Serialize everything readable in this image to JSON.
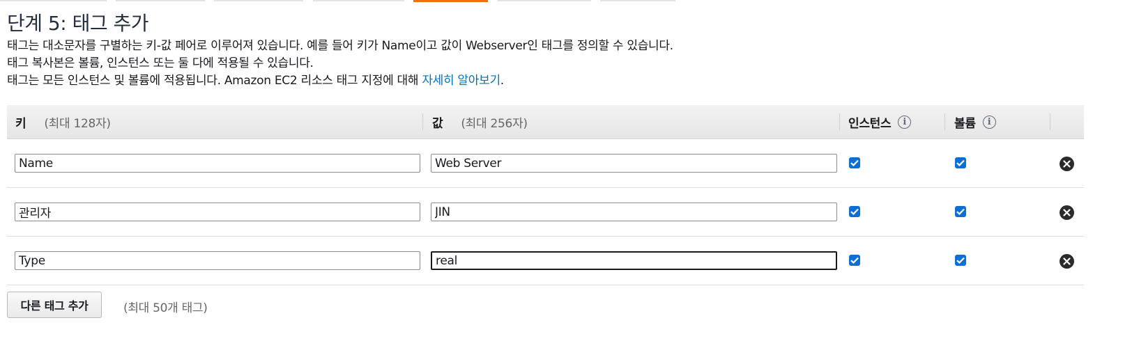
{
  "colors": {
    "accent": "#ec7211",
    "link": "#0073bb",
    "checkbox": "#0b6fd6",
    "header_bg": "#e9e9e9"
  },
  "page": {
    "title": "단계 5: 태그 추가",
    "description": [
      "태그는 대소문자를 구별하는 키-값 페어로 이루어져 있습니다. 예를 들어 키가 Name이고 값이 Webserver인 태그를 정의할 수 있습니다.",
      "태그 복사본은 볼륨, 인스턴스 또는 둘 다에 적용될 수 있습니다.",
      "태그는 모든 인스턴스 및 볼륨에 적용됩니다. Amazon EC2 리소스 태그 지정에 대해 "
    ],
    "learn_more_link": "자세히 알아보기",
    "period": "."
  },
  "table": {
    "headers": {
      "key": "키",
      "key_hint": "(최대 128자)",
      "value": "값",
      "value_hint": "(최대 256자)",
      "instances": "인스턴스",
      "volumes": "볼륨"
    },
    "info_icon": "info-icon",
    "rows": [
      {
        "key": "Name",
        "value": "Web Server",
        "instances": true,
        "volumes": true
      },
      {
        "key": "관리자",
        "value": "JIN",
        "instances": true,
        "volumes": true
      },
      {
        "key": "Type",
        "value": "real",
        "instances": true,
        "volumes": true
      }
    ],
    "remove_icon": "close-circle-icon"
  },
  "footer": {
    "add_button": "다른 태그 추가",
    "max_tags_hint": "(최대 50개 태그)"
  }
}
